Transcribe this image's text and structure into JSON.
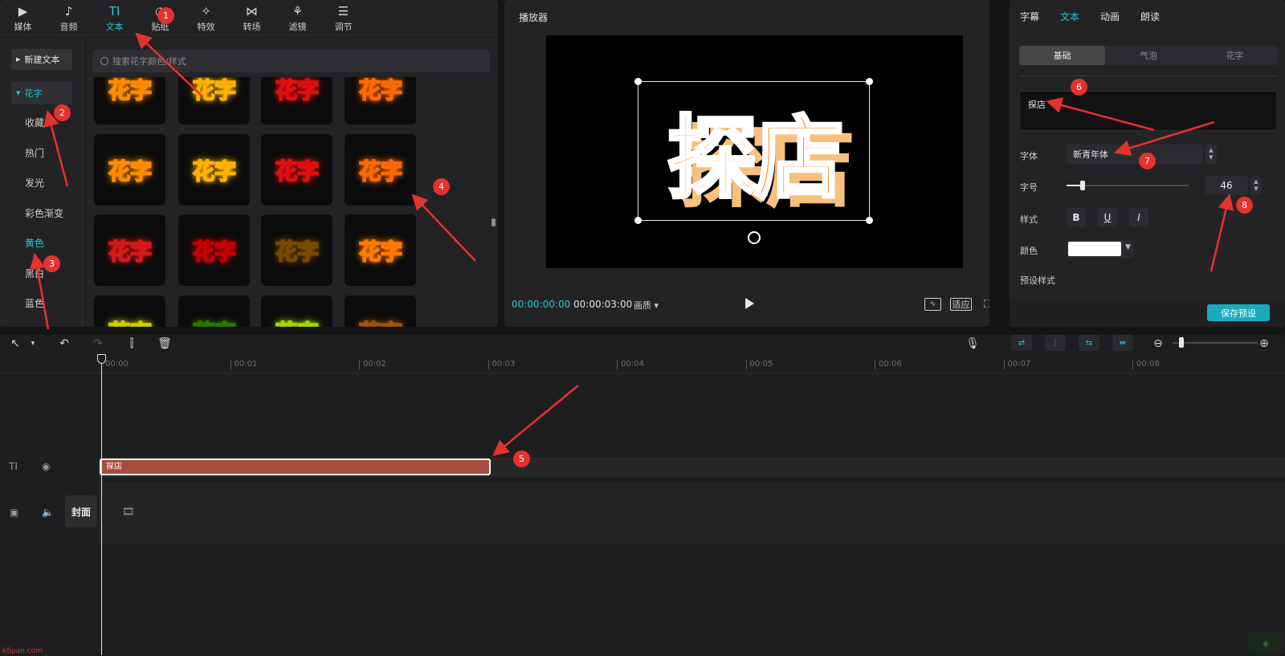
{
  "top_tabs": [
    {
      "label": "媒体",
      "icon": "media-icon",
      "glyph": "▶"
    },
    {
      "label": "音频",
      "icon": "audio-icon",
      "glyph": "♪"
    },
    {
      "label": "文本",
      "icon": "text-icon",
      "glyph": "TI"
    },
    {
      "label": "贴纸",
      "icon": "sticker-icon",
      "glyph": "◔"
    },
    {
      "label": "特效",
      "icon": "effects-icon",
      "glyph": "✧"
    },
    {
      "label": "转场",
      "icon": "transition-icon",
      "glyph": "⋈"
    },
    {
      "label": "滤镜",
      "icon": "filter-icon",
      "glyph": "⚘"
    },
    {
      "label": "调节",
      "icon": "adjust-icon",
      "glyph": "☰"
    }
  ],
  "active_tab": "文本",
  "sidebar": {
    "new_text": "新建文本",
    "active_group": "花字",
    "items": [
      "收藏",
      "热门",
      "发光",
      "彩色渐变",
      "黄色",
      "黑白",
      "蓝色"
    ],
    "active_item": "黄色"
  },
  "search": {
    "placeholder": "搜索花字颜色/样式"
  },
  "tiles": {
    "label": "花字",
    "rows": [
      [
        {
          "color": "#ffd400",
          "glow": "#ff8c00"
        },
        {
          "color": "#fff3a0",
          "glow": "#ffb300"
        },
        {
          "color": "#ffcc00",
          "glow": "#e01010"
        },
        {
          "color": "#ffe066",
          "glow": "#ff6a00"
        }
      ],
      [
        {
          "color": "#ffdb3a",
          "glow": "#d91a1a"
        },
        {
          "color": "#ffee88",
          "glow": "#c40000"
        },
        {
          "color": "#ffe066",
          "glow": "#7a4a00"
        },
        {
          "color": "#fff0b0",
          "glow": "#ff7a00"
        }
      ],
      [
        {
          "color": "#fffbd0",
          "glow": "#cccc00"
        },
        {
          "color": "#d6ff8a",
          "glow": "#2a7a00"
        },
        {
          "color": "#b8f0ff",
          "glow": "#a6d400"
        },
        {
          "color": "#ffe6b0",
          "glow": "#a0520a"
        }
      ]
    ],
    "badges": {
      "download": "⤓",
      "star": "☆"
    }
  },
  "player": {
    "title": "播放器",
    "overlay_text": "探店",
    "current_time": "00:00:00:00",
    "total_time": "00:00:03:00",
    "quality": "画质",
    "fit": "适应"
  },
  "properties": {
    "tabs": [
      "字幕",
      "文本",
      "动画",
      "朗读"
    ],
    "active_tab": "文本",
    "segments": [
      "基础",
      "气泡",
      "花字"
    ],
    "active_segment": "基础",
    "text_value": "探店",
    "font_label": "字体",
    "font_value": "新青年体",
    "size_label": "字号",
    "size_value": "46",
    "size_level": 0.13,
    "style_label": "样式",
    "style_buttons": [
      "B",
      "U",
      "I"
    ],
    "color_label": "颜色",
    "color_value": "#ffffff",
    "preset_label": "预设样式",
    "save_preset": "保存预设"
  },
  "timeline": {
    "ticks": [
      "00:00",
      "00:01",
      "00:02",
      "00:03",
      "00:04",
      "00:05",
      "00:06",
      "00:07",
      "00:08"
    ],
    "text_clip": "探店",
    "cover_label": "封面",
    "text_track_icon": "TI"
  },
  "annotations": [
    "1",
    "2",
    "3",
    "4",
    "5",
    "6",
    "7",
    "8"
  ],
  "accent": "#1fc7d6",
  "watermark": "k8pan.com"
}
